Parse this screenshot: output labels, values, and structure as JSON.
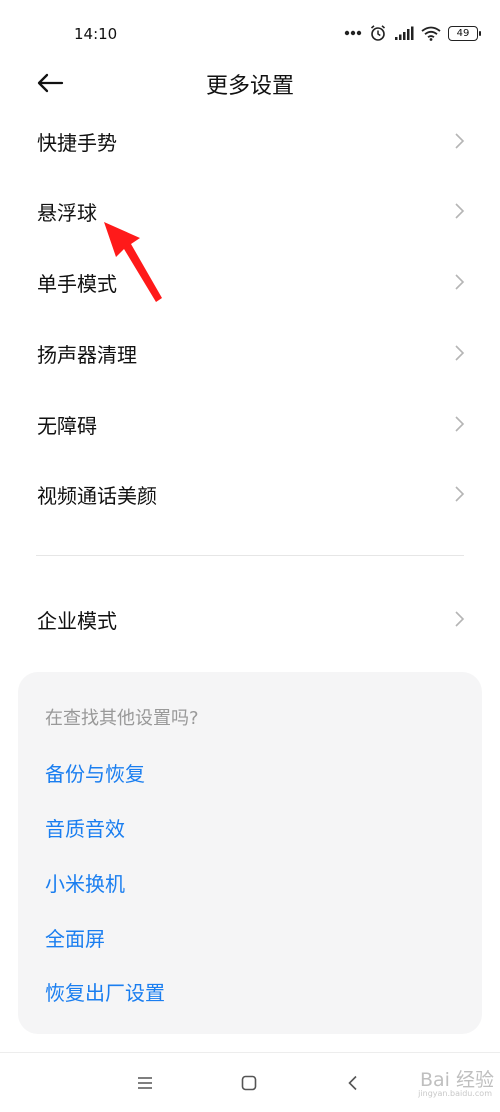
{
  "status_bar": {
    "time": "14:10",
    "battery": "49"
  },
  "header": {
    "title": "更多设置"
  },
  "menu_items": [
    {
      "label": "快捷手势"
    },
    {
      "label": "悬浮球"
    },
    {
      "label": "单手模式"
    },
    {
      "label": "扬声器清理"
    },
    {
      "label": "无障碍"
    },
    {
      "label": "视频通话美颜"
    }
  ],
  "menu_items_secondary": [
    {
      "label": "企业模式"
    }
  ],
  "suggestions": {
    "heading": "在查找其他设置吗?",
    "links": [
      {
        "label": "备份与恢复"
      },
      {
        "label": "音质音效"
      },
      {
        "label": "小米换机"
      },
      {
        "label": "全面屏"
      },
      {
        "label": "恢复出厂设置"
      }
    ]
  },
  "watermark": {
    "text": "Bai 经验",
    "sub": "jingyan.baidu.com"
  },
  "colors": {
    "link": "#1a7ef0",
    "annotation_arrow": "#ff1a1a",
    "card_bg": "#f5f5f6"
  }
}
